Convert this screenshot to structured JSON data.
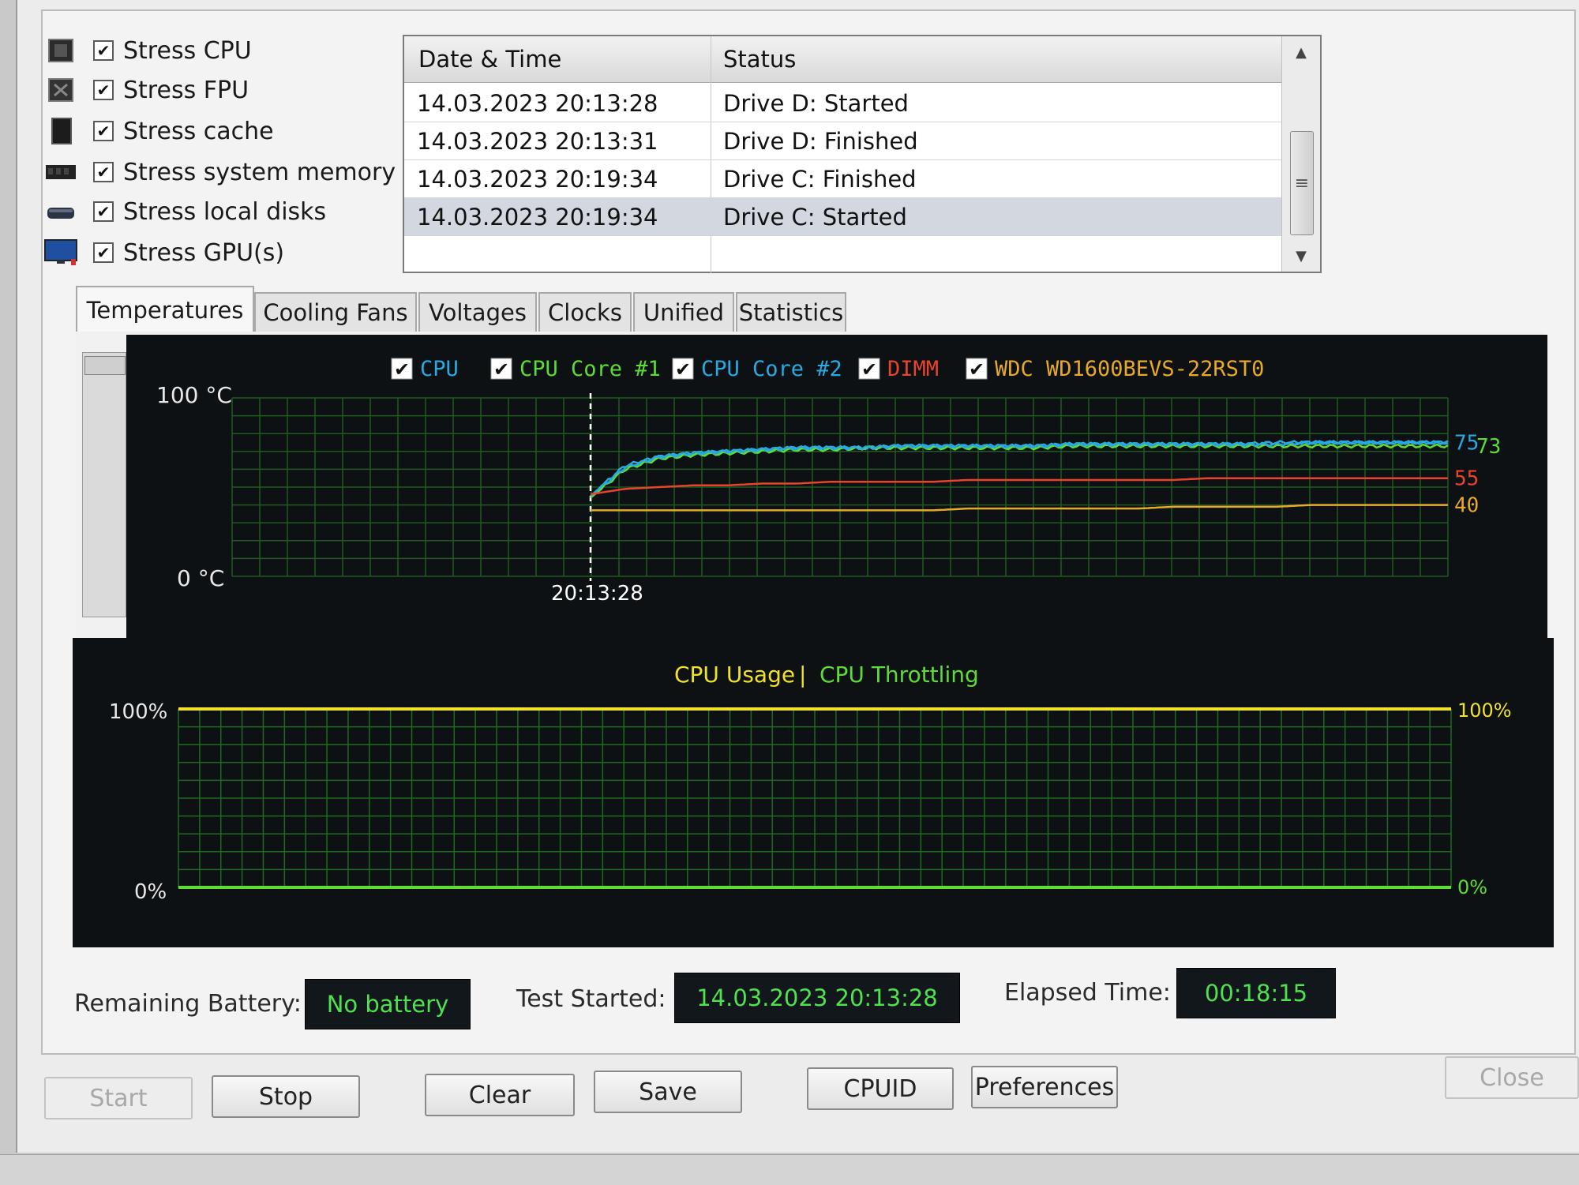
{
  "stress_options": [
    {
      "label": "Stress CPU",
      "checked": true,
      "icon": "cpu-chip-icon"
    },
    {
      "label": "Stress FPU",
      "checked": true,
      "icon": "fpu-chip-icon"
    },
    {
      "label": "Stress cache",
      "checked": true,
      "icon": "cache-chip-icon"
    },
    {
      "label": "Stress system memory",
      "checked": true,
      "icon": "memory-module-icon"
    },
    {
      "label": "Stress local disks",
      "checked": true,
      "icon": "hard-disk-icon"
    },
    {
      "label": "Stress GPU(s)",
      "checked": true,
      "icon": "monitor-icon"
    }
  ],
  "log": {
    "headers": {
      "datetime": "Date & Time",
      "status": "Status"
    },
    "rows": [
      {
        "datetime": "14.03.2023 20:13:28",
        "status": "Drive D: Started"
      },
      {
        "datetime": "14.03.2023 20:13:31",
        "status": "Drive D: Finished"
      },
      {
        "datetime": "14.03.2023 20:19:34",
        "status": "Drive C: Finished"
      },
      {
        "datetime": "14.03.2023 20:19:34",
        "status": "Drive C: Started"
      }
    ]
  },
  "tabs": [
    "Temperatures",
    "Cooling Fans",
    "Voltages",
    "Clocks",
    "Unified",
    "Statistics"
  ],
  "active_tab": "Temperatures",
  "chart_data": [
    {
      "type": "line",
      "legend": [
        {
          "name": "CPU",
          "color": "#29a9e1",
          "checked": true
        },
        {
          "name": "CPU Core #1",
          "color": "#5ddc36",
          "checked": true
        },
        {
          "name": "CPU Core #2",
          "color": "#29a9e1",
          "checked": true
        },
        {
          "name": "DIMM",
          "color": "#e8442c",
          "checked": true
        },
        {
          "name": "WDC WD1600BEVS-22RST0",
          "color": "#e8a92a",
          "checked": true
        }
      ],
      "ylabels": {
        "top": "100 °C",
        "bottom": "0 °C"
      },
      "ylim": [
        0,
        100
      ],
      "xlabel_marker": "20:13:28",
      "series": [
        {
          "name": "CPU",
          "color": "#29a9e1",
          "label": "75",
          "values": [
            45,
            62,
            67,
            69,
            70,
            71,
            72,
            72,
            72,
            73,
            73,
            73,
            73,
            73,
            74,
            74,
            74,
            74,
            74,
            74,
            75,
            75,
            75,
            75,
            75,
            75
          ]
        },
        {
          "name": "CPU Core #1",
          "color": "#5ddc36",
          "label": "73",
          "values": [
            44,
            60,
            66,
            68,
            69,
            70,
            71,
            71,
            72,
            72,
            72,
            72,
            72,
            72,
            73,
            73,
            73,
            73,
            73,
            73,
            73,
            73,
            73,
            73,
            73,
            73
          ]
        },
        {
          "name": "CPU Core #2",
          "color": "#29a9e1",
          "label": "",
          "values": [
            45,
            61,
            67,
            69,
            70,
            71,
            72,
            72,
            72,
            73,
            73,
            73,
            73,
            73,
            74,
            74,
            74,
            74,
            74,
            74,
            74,
            75,
            75,
            75,
            75,
            75
          ]
        },
        {
          "name": "DIMM",
          "color": "#e8442c",
          "label": "55",
          "values": [
            46,
            49,
            50,
            51,
            51,
            52,
            52,
            53,
            53,
            53,
            53,
            54,
            54,
            54,
            54,
            54,
            54,
            54,
            55,
            55,
            55,
            55,
            55,
            55,
            55,
            55
          ]
        },
        {
          "name": "WDC WD1600BEVS-22RST0",
          "color": "#e8a92a",
          "label": "40",
          "values": [
            37,
            37,
            37,
            37,
            37,
            37,
            37,
            37,
            37,
            37,
            37,
            38,
            38,
            38,
            38,
            38,
            38,
            39,
            39,
            39,
            39,
            40,
            40,
            40,
            40,
            40
          ]
        }
      ]
    },
    {
      "type": "line",
      "title_parts": [
        {
          "text": "CPU Usage",
          "color": "#f0e12a"
        },
        {
          "text": "|",
          "color": "#f0e12a"
        },
        {
          "text": "CPU Throttling",
          "color": "#5ddc36"
        }
      ],
      "ylabels": {
        "top": "100%",
        "bottom": "0%"
      },
      "right_labels": {
        "top": "100%",
        "bottom": "0%"
      },
      "ylim": [
        0,
        100
      ],
      "series": [
        {
          "name": "CPU Usage",
          "color": "#f0e12a",
          "value": 100
        },
        {
          "name": "CPU Throttling",
          "color": "#5ddc36",
          "value": 0
        }
      ]
    }
  ],
  "status": {
    "battery_label": "Remaining Battery:",
    "battery_value": "No battery",
    "started_label": "Test Started:",
    "started_value": "14.03.2023 20:13:28",
    "elapsed_label": "Elapsed Time:",
    "elapsed_value": "00:18:15"
  },
  "buttons": {
    "start": "Start",
    "stop": "Stop",
    "clear": "Clear",
    "save": "Save",
    "cpuid": "CPUID",
    "preferences": "Preferences",
    "close": "Close"
  }
}
